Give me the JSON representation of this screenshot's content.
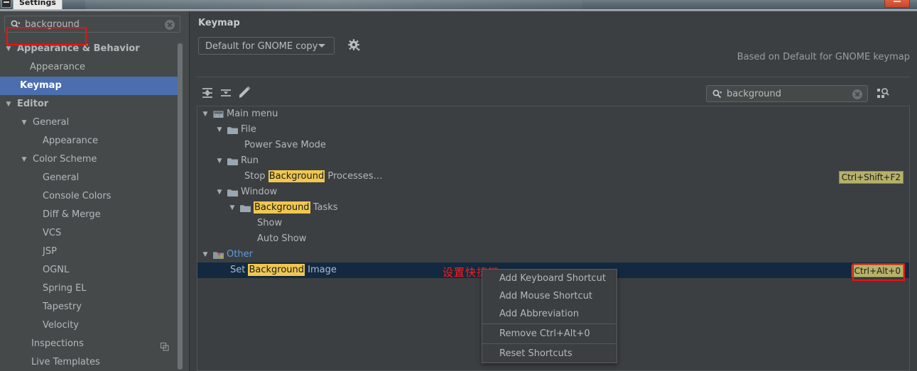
{
  "window": {
    "tab_title": "Settings",
    "close_button": "close-window"
  },
  "sidebar": {
    "search": {
      "value": "background",
      "placeholder": "",
      "icon": "search-icon",
      "clear_icon": "clear-icon"
    },
    "items": [
      {
        "label": "Appearance & Behavior",
        "indent": 8,
        "arrow": "▼",
        "bold": true,
        "selected": false
      },
      {
        "label": "Appearance",
        "indent": 42,
        "arrow": "",
        "bold": false,
        "selected": false
      },
      {
        "label": "Keymap",
        "indent": 28,
        "arrow": "",
        "bold": true,
        "selected": true
      },
      {
        "label": "Editor",
        "indent": 8,
        "arrow": "▼",
        "bold": true,
        "selected": false
      },
      {
        "label": "General",
        "indent": 30,
        "arrow": "▼",
        "bold": false,
        "selected": false
      },
      {
        "label": "Appearance",
        "indent": 60,
        "arrow": "",
        "bold": false,
        "selected": false
      },
      {
        "label": "Color Scheme",
        "indent": 30,
        "arrow": "▼",
        "bold": false,
        "selected": false
      },
      {
        "label": "General",
        "indent": 60,
        "arrow": "",
        "bold": false,
        "selected": false
      },
      {
        "label": "Console Colors",
        "indent": 60,
        "arrow": "",
        "bold": false,
        "selected": false
      },
      {
        "label": "Diff & Merge",
        "indent": 60,
        "arrow": "",
        "bold": false,
        "selected": false
      },
      {
        "label": "VCS",
        "indent": 60,
        "arrow": "",
        "bold": false,
        "selected": false
      },
      {
        "label": "JSP",
        "indent": 60,
        "arrow": "",
        "bold": false,
        "selected": false
      },
      {
        "label": "OGNL",
        "indent": 60,
        "arrow": "",
        "bold": false,
        "selected": false
      },
      {
        "label": "Spring EL",
        "indent": 60,
        "arrow": "",
        "bold": false,
        "selected": false
      },
      {
        "label": "Tapestry",
        "indent": 60,
        "arrow": "",
        "bold": false,
        "selected": false
      },
      {
        "label": "Velocity",
        "indent": 60,
        "arrow": "",
        "bold": false,
        "selected": false
      },
      {
        "label": "Inspections",
        "indent": 44,
        "arrow": "",
        "bold": false,
        "selected": false,
        "badge_icon": "duplicate-icon"
      },
      {
        "label": "Live Templates",
        "indent": 44,
        "arrow": "",
        "bold": false,
        "selected": false
      }
    ]
  },
  "main": {
    "title": "Keymap",
    "keymap_select": {
      "value": "Default for GNOME copy",
      "arrow_icon": "chevron-down-icon"
    },
    "gear_icon": "gear-icon",
    "based_on": "Based on Default for GNOME keymap",
    "toolbar": [
      {
        "name": "expand-all-icon",
        "tooltip": "Expand All"
      },
      {
        "name": "collapse-all-icon",
        "tooltip": "Collapse All"
      },
      {
        "name": "edit-shortcut-icon",
        "tooltip": "Edit Shortcut"
      }
    ],
    "filter_search": {
      "value": "background",
      "icon": "search-icon",
      "clear_icon": "clear-icon"
    },
    "find_shortcut_icon": "find-by-shortcut-icon",
    "annotation_cn": "设置快捷键",
    "highlight_term": "Background",
    "tree": [
      {
        "indent": 8,
        "arrow": "▼",
        "icon": "main-menu-icon",
        "text": "Main menu",
        "shortcut": "",
        "selected": false,
        "style": "plain"
      },
      {
        "indent": 28,
        "arrow": "▼",
        "icon": "folder-icon",
        "text": "File",
        "shortcut": "",
        "selected": false,
        "style": "plain"
      },
      {
        "indent": 66,
        "arrow": "",
        "icon": "",
        "text": "Power Save Mode",
        "shortcut": "",
        "selected": false,
        "style": "plain"
      },
      {
        "indent": 28,
        "arrow": "▼",
        "icon": "folder-icon",
        "text": "Run",
        "shortcut": "",
        "selected": false,
        "style": "plain"
      },
      {
        "indent": 66,
        "arrow": "",
        "icon": "",
        "text": "Stop Background Processes…",
        "shortcut": "Ctrl+Shift+F2",
        "selected": false,
        "style": "plain"
      },
      {
        "indent": 28,
        "arrow": "▼",
        "icon": "folder-icon",
        "text": "Window",
        "shortcut": "",
        "selected": false,
        "style": "plain"
      },
      {
        "indent": 46,
        "arrow": "▼",
        "icon": "folder-icon",
        "text": "Background Tasks",
        "shortcut": "",
        "selected": false,
        "style": "plain"
      },
      {
        "indent": 84,
        "arrow": "",
        "icon": "",
        "text": "Show",
        "shortcut": "",
        "selected": false,
        "style": "plain"
      },
      {
        "indent": 84,
        "arrow": "",
        "icon": "",
        "text": "Auto Show",
        "shortcut": "",
        "selected": false,
        "style": "plain"
      },
      {
        "indent": 8,
        "arrow": "▼",
        "icon": "other-group-icon",
        "text": "Other",
        "shortcut": "",
        "selected": false,
        "style": "other"
      },
      {
        "indent": 46,
        "arrow": "",
        "icon": "",
        "text": "Set Background Image",
        "shortcut": "Ctrl+Alt+0",
        "selected": true,
        "style": "plain"
      }
    ],
    "context_menu": [
      {
        "label": "Add Keyboard Shortcut",
        "separator_after": false
      },
      {
        "label": "Add Mouse Shortcut",
        "separator_after": false
      },
      {
        "label": "Add Abbreviation",
        "separator_after": true
      },
      {
        "label": "Remove Ctrl+Alt+0",
        "separator_after": true
      },
      {
        "label": "Reset Shortcuts",
        "separator_after": false
      }
    ]
  },
  "colors": {
    "accent_selection": "#4b6eaf",
    "row_selection": "#13293f",
    "highlight": "#f0c850",
    "shortcut_badge": "#b5b16a",
    "annotation_red": "#ff1d1d",
    "panel_bg": "#3c3f41",
    "sidebar_bg": "#45494a",
    "link_blue": "#5e9bde"
  }
}
